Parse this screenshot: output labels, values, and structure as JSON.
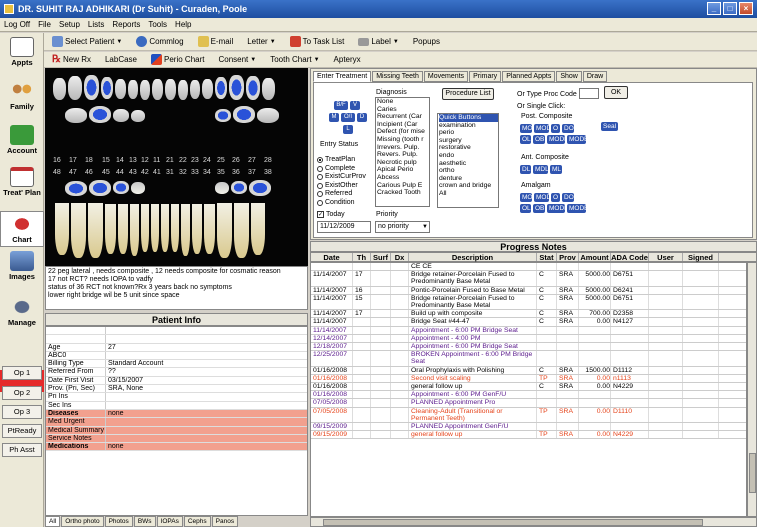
{
  "window": {
    "title": "DR. SUHIT RAJ ADHIKARI (Dr Suhit) - Curaden, Poole"
  },
  "menu": [
    "Log Off",
    "File",
    "Setup",
    "Lists",
    "Reports",
    "Tools",
    "Help"
  ],
  "toolbar1": {
    "select_patient": "Select Patient",
    "commlog": "Commlog",
    "email": "E-mail",
    "letter": "Letter",
    "to_task_list": "To Task List",
    "label": "Label",
    "popups": "Popups"
  },
  "toolbar2": {
    "new_rx": "New Rx",
    "labcase": "LabCase",
    "perio_chart": "Perio Chart",
    "consent": "Consent",
    "tooth_chart": "Tooth Chart",
    "apteryx": "Apteryx"
  },
  "sidebar": {
    "appts": "Appts",
    "family": "Family",
    "account": "Account",
    "treat_plan": "Treat' Plan",
    "chart": "Chart",
    "images": "Images",
    "manage": "Manage",
    "ops": [
      "Op 1",
      "Op 2",
      "Op 3"
    ],
    "pt_ready": "PtReady",
    "ph_asst": "Ph Asst"
  },
  "tooth_numbers": {
    "upper": [
      "16",
      "17",
      "18",
      "15",
      "14",
      "13",
      "12",
      "11",
      "21",
      "22",
      "23",
      "24",
      "25",
      "26",
      "27",
      "28"
    ],
    "lower": [
      "48",
      "47",
      "46",
      "45",
      "44",
      "43",
      "42",
      "41",
      "31",
      "32",
      "33",
      "34",
      "35",
      "36",
      "37",
      "38"
    ]
  },
  "chart_note": [
    "22 peg lateral , needs composite , 12 needs composite for cosmatic reason",
    "17 not RCT? needs IOPA to vadfy",
    "status of 36 RCT not known?Rx 3 years back no symptoms",
    "lower right bridge wil be 5 unit since space"
  ],
  "patient_info": {
    "header": "Patient Info",
    "rows": [
      {
        "k": "",
        "v": "",
        "style": ""
      },
      {
        "k": "",
        "v": "",
        "style": ""
      },
      {
        "k": "Age",
        "v": "27",
        "style": ""
      },
      {
        "k": "ABC0",
        "v": "",
        "style": ""
      },
      {
        "k": "Billing Type",
        "v": "Standard Account",
        "style": ""
      },
      {
        "k": "Referred From",
        "v": "??",
        "style": ""
      },
      {
        "k": "Date First Visit",
        "v": "03/15/2007",
        "style": ""
      },
      {
        "k": "Prov. (Pri, Sec)",
        "v": "SRA, None",
        "style": ""
      },
      {
        "k": "Pri Ins",
        "v": "",
        "style": ""
      },
      {
        "k": "Sec Ins",
        "v": "",
        "style": ""
      },
      {
        "k": "Diseases",
        "v": "none",
        "style": "pink bold"
      },
      {
        "k": "Med Urgent",
        "v": "",
        "style": "pink"
      },
      {
        "k": "Medical Summary",
        "v": "",
        "style": "pink"
      },
      {
        "k": "Service Notes",
        "v": "",
        "style": "pink"
      },
      {
        "k": "Medications",
        "v": "none",
        "style": "pink bold"
      }
    ]
  },
  "bottom_tabs": [
    "All",
    "Ortho photo",
    "Photos",
    "BWs",
    "IOPAs",
    "Cephs",
    "Panos"
  ],
  "treatment": {
    "tabs": [
      "Enter Treatment",
      "Missing Teeth",
      "Movements",
      "Primary",
      "Planned Appts",
      "Show",
      "Draw"
    ],
    "surfaces": [
      "B/F",
      "V",
      "M",
      "O/I",
      "D",
      "L"
    ],
    "entry_status_label": "Entry Status",
    "entry_status": [
      "TreatPlan",
      "Complete",
      "ExistCurProv",
      "ExistOther",
      "Referred",
      "Condition"
    ],
    "today_label": "Today",
    "date": "11/12/2009",
    "diagnosis_label": "Diagnosis",
    "diagnosis": [
      "None",
      "Caries",
      "Recurrent (Car",
      "Incipient (Car",
      "Defect (for mise",
      "Missing (tooth r",
      "Irrevers. Pulp.",
      "Revers. Pulp.",
      "Necrotic pulp",
      "Apical Perio",
      "Abcess",
      "Carious Pulp E",
      "Cracked Tooth"
    ],
    "priority_label": "Priority",
    "priority": "no priority",
    "procedure_list_btn": "Procedure List",
    "or_type_label": "Or  Type Proc Code",
    "ok_btn": "OK",
    "single_click_label": "Or Single Click:",
    "quick_buttons": [
      "Quick Buttons",
      "examination",
      "perio",
      "surgery",
      "restorative",
      "endo",
      "aesthetic",
      "ortho",
      "denture",
      "crown and bridge",
      "All"
    ],
    "post_comp_label": "Post. Composite",
    "post_comp": [
      "MO",
      "MOD",
      "O",
      "DO",
      "Seal",
      "OL",
      "OB",
      "MODL",
      "MODB"
    ],
    "ant_comp_label": "Ant. Composite",
    "ant_comp": [
      "DL",
      "MDL",
      "ML"
    ],
    "amalgam_label": "Amalgam",
    "amalgam": [
      "MO",
      "MOD",
      "O",
      "DO",
      "OL",
      "OB",
      "MODL",
      "MODB"
    ]
  },
  "progress_notes": {
    "header": "Progress Notes",
    "columns": [
      "Date",
      "Th",
      "Surf",
      "Dx",
      "Description",
      "Stat",
      "Prov",
      "Amount",
      "ADA Code",
      "User",
      "Signed"
    ],
    "rows": [
      {
        "date": "",
        "th": "",
        "surf": "",
        "dx": "",
        "desc": "CE CE",
        "stat": "",
        "prov": "",
        "amt": "",
        "code": "",
        "c": "black"
      },
      {
        "date": "11/14/2007",
        "th": "17",
        "surf": "",
        "dx": "",
        "desc": "Bridge retainer-Porcelain Fused to Predominantly Base Metal",
        "stat": "C",
        "prov": "SRA",
        "amt": "5000.00",
        "code": "D6751",
        "c": "black"
      },
      {
        "date": "11/14/2007",
        "th": "16",
        "surf": "",
        "dx": "",
        "desc": "Pontic-Porcelain Fused to Base Metal",
        "stat": "C",
        "prov": "SRA",
        "amt": "5000.00",
        "code": "D6241",
        "c": "black"
      },
      {
        "date": "11/14/2007",
        "th": "15",
        "surf": "",
        "dx": "",
        "desc": "Bridge retainer-Porcelain Fused to Predominantly Base Metal",
        "stat": "C",
        "prov": "SRA",
        "amt": "5000.00",
        "code": "D6751",
        "c": "black"
      },
      {
        "date": "11/14/2007",
        "th": "17",
        "surf": "",
        "dx": "",
        "desc": "Build up with composite",
        "stat": "C",
        "prov": "SRA",
        "amt": "700.00",
        "code": "D2358",
        "c": "black"
      },
      {
        "date": "11/14/2007",
        "th": "",
        "surf": "",
        "dx": "",
        "desc": "Bridge Seat #44-47",
        "stat": "C",
        "prov": "SRA",
        "amt": "0.00",
        "code": "N4127",
        "c": "black"
      },
      {
        "date": "11/14/2007",
        "th": "",
        "surf": "",
        "dx": "",
        "desc": "Appointment - 6:00 PM Bridge Seat",
        "stat": "",
        "prov": "",
        "amt": "",
        "code": "",
        "c": "purple"
      },
      {
        "date": "12/14/2007",
        "th": "",
        "surf": "",
        "dx": "",
        "desc": "Appointment - 4:00 PM",
        "stat": "",
        "prov": "",
        "amt": "",
        "code": "",
        "c": "purple"
      },
      {
        "date": "12/18/2007",
        "th": "",
        "surf": "",
        "dx": "",
        "desc": "Appointment - 6:00 PM Bridge Seat",
        "stat": "",
        "prov": "",
        "amt": "",
        "code": "",
        "c": "purple"
      },
      {
        "date": "12/25/2007",
        "th": "",
        "surf": "",
        "dx": "",
        "desc": "BROKEN Appointment - 6:00 PM Bridge Seat",
        "stat": "",
        "prov": "",
        "amt": "",
        "code": "",
        "c": "purple"
      },
      {
        "date": "01/16/2008",
        "th": "",
        "surf": "",
        "dx": "",
        "desc": "Oral Prophylaxis with Polishing",
        "stat": "C",
        "prov": "SRA",
        "amt": "1500.00",
        "code": "D1112",
        "c": "black"
      },
      {
        "date": "01/16/2008",
        "th": "",
        "surf": "",
        "dx": "",
        "desc": "Second visit scaling",
        "stat": "TP",
        "prov": "SRA",
        "amt": "0.00",
        "code": "n1113",
        "c": "orange"
      },
      {
        "date": "01/16/2008",
        "th": "",
        "surf": "",
        "dx": "",
        "desc": "general follow up",
        "stat": "C",
        "prov": "SRA",
        "amt": "0.00",
        "code": "N4229",
        "c": "black"
      },
      {
        "date": "01/16/2008",
        "th": "",
        "surf": "",
        "dx": "",
        "desc": "Appointment - 6:00 PM GenF/U",
        "stat": "",
        "prov": "",
        "amt": "",
        "code": "",
        "c": "purple"
      },
      {
        "date": "07/05/2008",
        "th": "",
        "surf": "",
        "dx": "",
        "desc": "PLANNED Appointment Pro",
        "stat": "",
        "prov": "",
        "amt": "",
        "code": "",
        "c": "purple"
      },
      {
        "date": "07/05/2008",
        "th": "",
        "surf": "",
        "dx": "",
        "desc": "Cleaning-Adult (Transitional or Permanent Teeth)",
        "stat": "TP",
        "prov": "SRA",
        "amt": "0.00",
        "code": "D1110",
        "c": "orange"
      },
      {
        "date": "09/15/2009",
        "th": "",
        "surf": "",
        "dx": "",
        "desc": "PLANNED Appointment GenF/U",
        "stat": "",
        "prov": "",
        "amt": "",
        "code": "",
        "c": "purple"
      },
      {
        "date": "09/15/2009",
        "th": "",
        "surf": "",
        "dx": "",
        "desc": "general follow up",
        "stat": "TP",
        "prov": "SRA",
        "amt": "0.00",
        "code": "N4229",
        "c": "orange"
      }
    ]
  }
}
